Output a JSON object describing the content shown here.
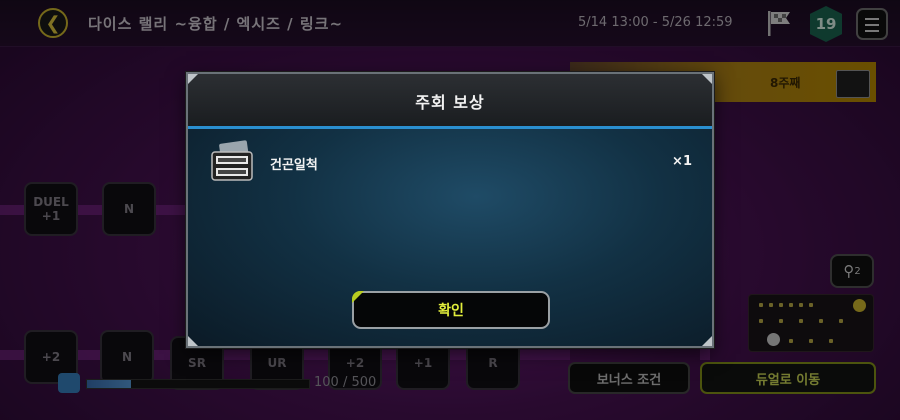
{
  "topbar": {
    "event_title": "다이스 랠리   ~융합 / 엑시즈 / 링크~",
    "event_period": "5/14 13:00 - 5/26 12:59",
    "level_badge": "19"
  },
  "board": {
    "tile_labels": [
      "DUEL +1",
      "N",
      "+2",
      "N",
      "SR",
      "UR",
      "+2",
      "+1",
      "R"
    ],
    "banner_week": "8주째",
    "zoom_label": "2",
    "progress": {
      "text": "100 / 500",
      "fraction": 0.2
    }
  },
  "bottom": {
    "bonus_label": "보너스 조건",
    "duel_label": "듀얼로 이동"
  },
  "modal": {
    "title": "주회 보상",
    "reward": {
      "name": "건곤일척",
      "quantity": "×1"
    },
    "confirm_label": "확인"
  },
  "colors": {
    "accent_blue": "#2a8fd0",
    "confirm_text": "#e3ef3c",
    "board_bg": "#4b1356"
  }
}
